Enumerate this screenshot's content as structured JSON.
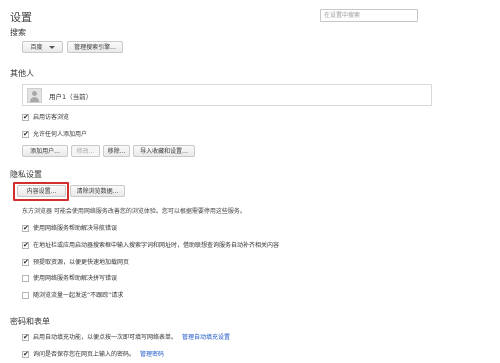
{
  "header": {
    "title": "设置",
    "search_placeholder": "在设置中搜索"
  },
  "search_section": {
    "title": "搜索",
    "engine_selected": "百度",
    "manage_button": "管理搜索引擎..."
  },
  "people_section": {
    "title": "其他人",
    "current_user": "用户1（当前）",
    "checkboxes": [
      {
        "label": "启用访客浏览",
        "checked": true
      },
      {
        "label": "允许任何人添加用户",
        "checked": true
      }
    ],
    "buttons": {
      "add": "添加用户...",
      "edit": "修改...",
      "remove": "移除...",
      "import": "导入收藏和设置..."
    }
  },
  "privacy_section": {
    "title": "隐私设置",
    "content_settings_button": "内容设置...",
    "clear_data_button": "清除浏览数据...",
    "description": "东方浏览器 可能会使用网络服务改善您的浏览体验。您可以根据需要停用这些服务。",
    "checkboxes": [
      {
        "label": "使用网络服务帮助解决导航错误",
        "checked": true
      },
      {
        "label": "在地址栏或应用启动器搜索框中输入搜索字词和网址时，借助联想查询服务自动补齐相关内容",
        "checked": true
      },
      {
        "label": "预提取资源，以便更快速地加载网页",
        "checked": true
      },
      {
        "label": "使用网络服务帮助解决拼写错误",
        "checked": false
      },
      {
        "label": "随浏览流量一起发送“不跟踪”请求",
        "checked": false
      }
    ]
  },
  "passwords_section": {
    "title": "密码和表单",
    "autofill": {
      "label": "启用自动填充功能，以便点按一次即可填写网络表单。",
      "checked": true,
      "link": "管理自动填充设置"
    },
    "save_passwords": {
      "label": "询问是否保存您在网页上输入的密码。",
      "checked": true,
      "link": "管理密码"
    }
  },
  "colors": {
    "link": "#1a55c8",
    "highlight": "#d32f2f"
  }
}
